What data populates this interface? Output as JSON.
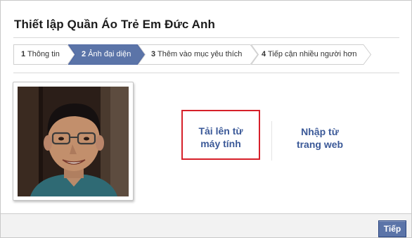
{
  "dialog": {
    "title": "Thiết lập Quần Áo Trẻ Em Đức Anh"
  },
  "steps": [
    {
      "num": "1",
      "label": "Thông tin",
      "active": false
    },
    {
      "num": "2",
      "label": "Ảnh đại diện",
      "active": true
    },
    {
      "num": "3",
      "label": "Thêm vào mục yêu thích",
      "active": false
    },
    {
      "num": "4",
      "label": "Tiếp cận nhiều người hơn",
      "active": false
    }
  ],
  "upload": {
    "from_computer_line1": "Tải lên từ",
    "from_computer_line2": "máy tính",
    "from_web_line1": "Nhập từ",
    "from_web_line2": "trang web"
  },
  "footer": {
    "next_label": "Tiếp"
  },
  "colors": {
    "link": "#3b5998",
    "active_step": "#5b74a8",
    "highlight_box": "#d6202a"
  }
}
